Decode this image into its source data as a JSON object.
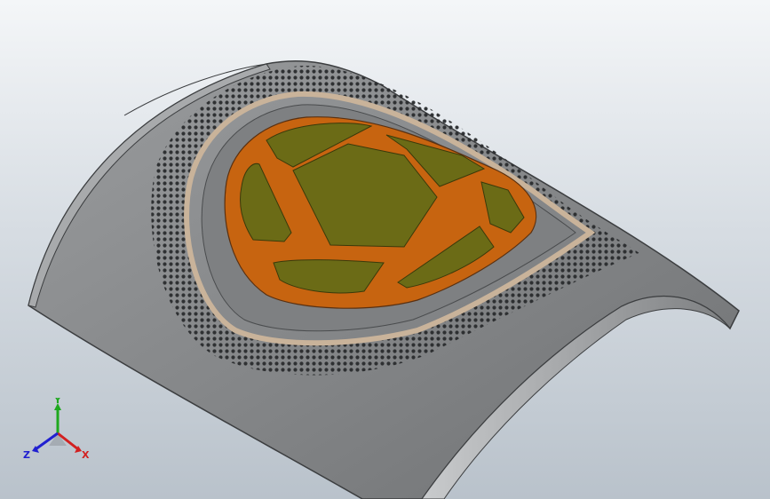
{
  "viewport": {
    "background_top": "#f4f6f8",
    "background_bottom": "#b9c2cb"
  },
  "model": {
    "description_icon": "cad-shell-model",
    "shell_color": "#8a8c8e",
    "shell_edge_color": "#3c3e40",
    "perforation_color": "#2a2c2e",
    "trim_ring_color": "#c9b39a",
    "frame_color": "#c76410",
    "pad_color": "#6b6b16"
  },
  "triad": {
    "icon": "coordinate-triad-icon",
    "x_label": "X",
    "y_label": "Y",
    "z_label": "Z",
    "x_color": "#d22020",
    "y_color": "#1ea81e",
    "z_color": "#2020d0"
  }
}
